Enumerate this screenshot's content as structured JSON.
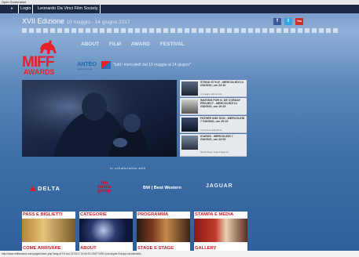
{
  "window_title": "Open Screenshot",
  "topbar": {
    "login": "Login",
    "society": "Leonardo Da Vinci Film Society"
  },
  "header": {
    "edition": "XVII Edizione",
    "dates": "10 maggio - 14 giugno 2017"
  },
  "social": {
    "facebook": "f",
    "twitter": "t",
    "youtube": "You"
  },
  "logo": {
    "line1": "MIFF",
    "line2": "AWARDS"
  },
  "nav": {
    "items": [
      "ABOUT",
      "FILM",
      "AWARD",
      "FESTIVAL"
    ]
  },
  "partner": {
    "name": "ANTEO",
    "sub": "spazioCinema",
    "tagline": "\"tutti i mercoledì dal 10 maggio al 14 giugno\""
  },
  "schedule": [
    {
      "title": "STRAD STYLE - MERCOLEDÌ 14 GIUGNO, ore 22:30",
      "sub": "Un viaggio nella terra di ..."
    },
    {
      "title": "WAITING FOR G. DE CORDAY PROJECT - MERCOLEDÌ 14 GIUGNO, ore 19:45",
      "sub": ""
    },
    {
      "title": "FATHER AND SON - MERCOLEDÌ 7 GIUGNO, ore 20:15",
      "sub": "Una ricerca della libertà"
    },
    {
      "title": "ICARUS - MERCOLEDÌ 7 GIUGNO, ore 22:00",
      "sub": "Nel film Bryan Fogel indaga sul"
    }
  ],
  "collab_label": "in collaboration with",
  "sponsors": {
    "delta": "DELTA",
    "tvn_line1": "tvn",
    "tvn_line2": "media",
    "tvn_line3": "group",
    "bestwestern": "BW | Best Western",
    "jaguar": "JAGUAR"
  },
  "cards": [
    "PASS E BIGLIETTI",
    "CATEGORIE",
    "PROGRAMMA",
    "STAMPA E MEDIA"
  ],
  "cards_row2": [
    "COME ARRIVARE",
    "ABOUT",
    "STAGE E STAGE",
    "GALLERY"
  ],
  "statusbar": "http://www.miffawards.com/pages/index.php?lang=it Fri Jun 23 2017 14:00:00 GMT+0200 (ora legale Europa occidentale)"
}
